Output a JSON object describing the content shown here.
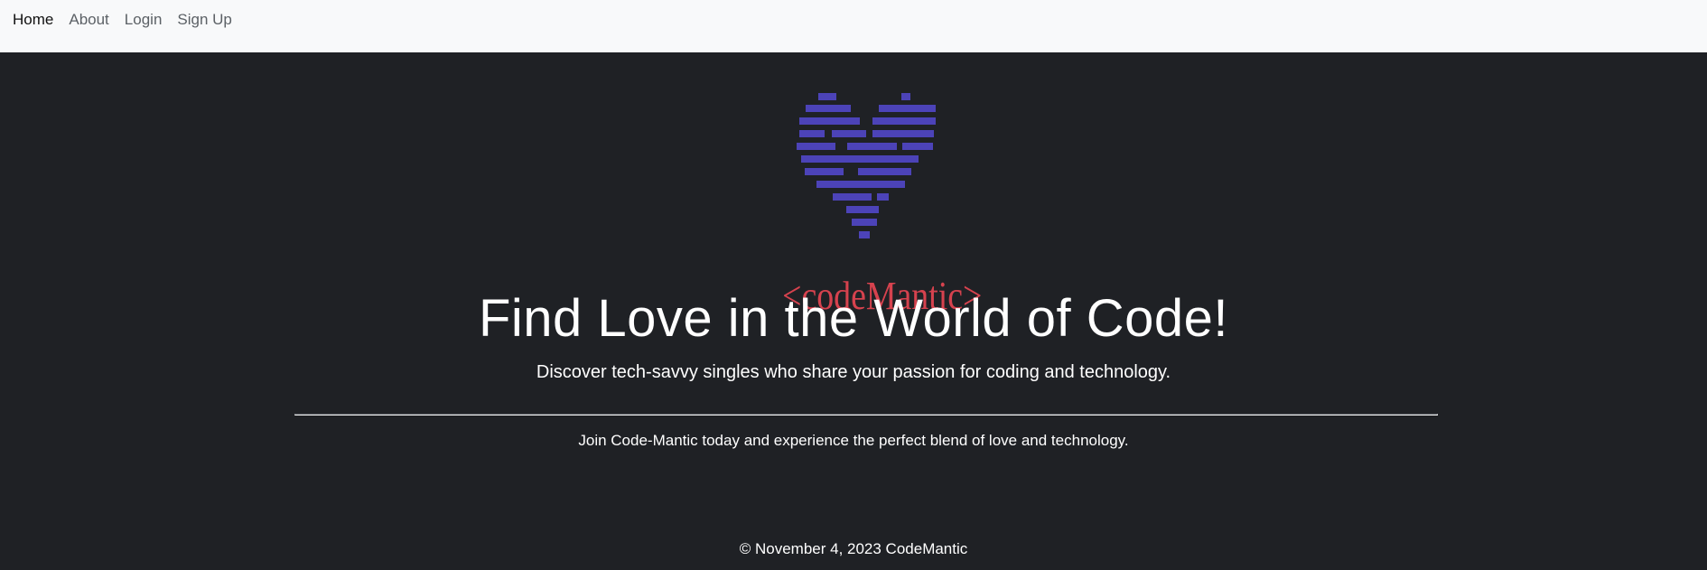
{
  "nav": {
    "items": [
      {
        "label": "Home",
        "active": true
      },
      {
        "label": "About",
        "active": false
      },
      {
        "label": "Login",
        "active": false
      },
      {
        "label": "Sign Up",
        "active": false
      }
    ]
  },
  "logo": {
    "text": "<codeMantic>",
    "heart_color": "#4c43b8",
    "text_color": "#d6424e"
  },
  "hero": {
    "headline": "Find Love in the World of Code!",
    "lead": "Discover tech-savvy singles who share your passion for coding and technology.",
    "join": "Join Code-Mantic today and experience the perfect blend of love and technology."
  },
  "footer": {
    "text": "© November 4, 2023 CodeMantic"
  },
  "colors": {
    "navbar_bg": "#f8f9fa",
    "page_bg": "#1f2125"
  }
}
